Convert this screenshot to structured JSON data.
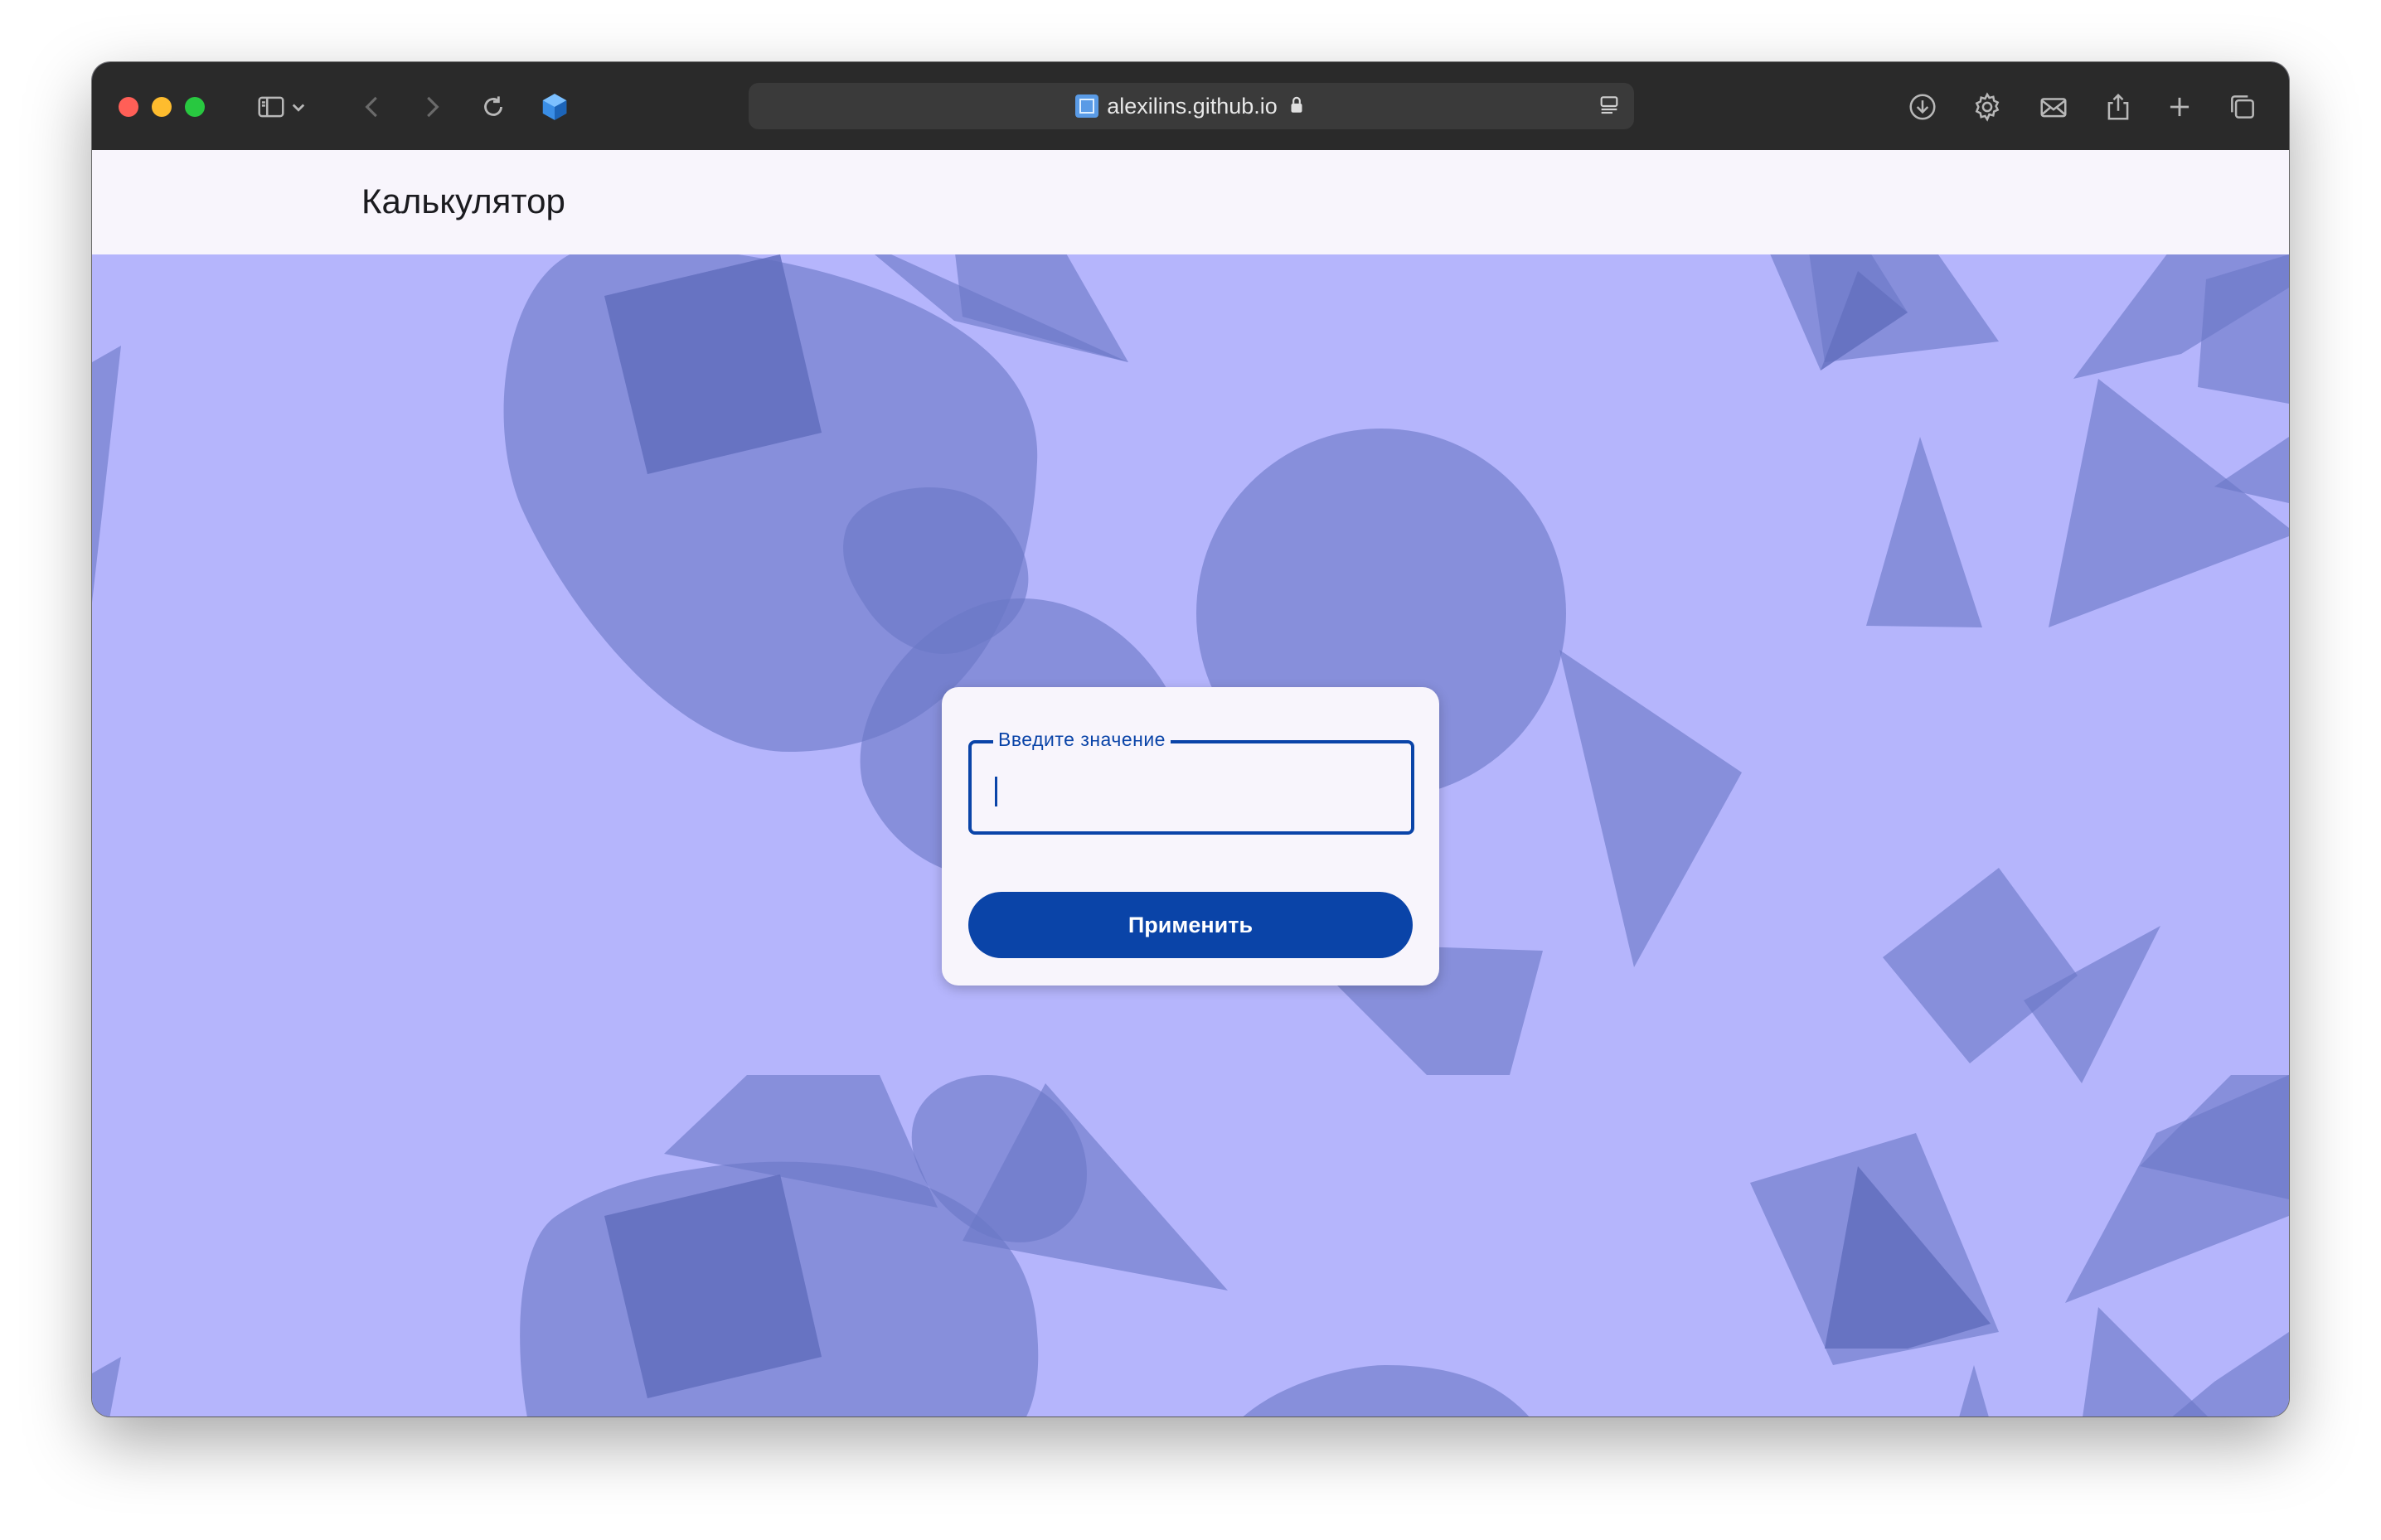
{
  "browser": {
    "url": "alexilins.github.io",
    "traffic_lights": {
      "close": "#ff5f57",
      "minimize": "#febc2e",
      "zoom": "#28c840"
    },
    "toolbar_icons": [
      "sidebar-icon",
      "chevron-down-icon",
      "back-icon",
      "forward-icon",
      "reload-icon",
      "extension-cube-icon",
      "site-favicon",
      "lock-icon",
      "reader-icon",
      "download-icon",
      "gear-icon",
      "mail-icon",
      "share-icon",
      "plus-icon",
      "tabs-overview-icon"
    ]
  },
  "app": {
    "title": "Калькулятор",
    "input_label": "Введите значение",
    "input_value": "",
    "apply_label": "Применить"
  },
  "colors": {
    "background": "#b5b5fc",
    "shape_fill": "#6b78c6",
    "primary": "#0a44a8",
    "surface": "#f8f5fc"
  }
}
